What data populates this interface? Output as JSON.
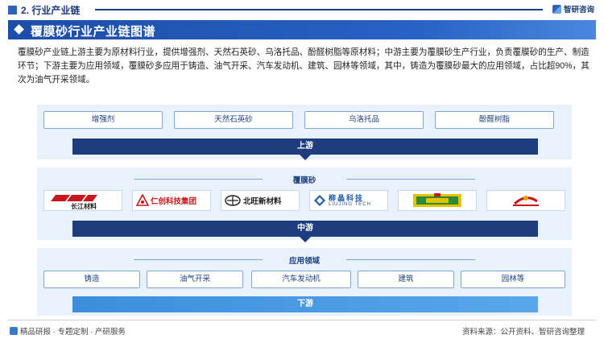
{
  "header": {
    "section": "2. 行业产业链",
    "brand": "智研咨询"
  },
  "title": "覆膜砂行业产业链图谱",
  "description": "覆膜砂产业链上游主要为原材料行业，提供增强剂、天然石英砂、乌洛托品、酚醛树脂等原材料；中游主要为覆膜砂生产行业，负责覆膜砂的生产、制造环节；下游主要为应用领域，覆膜砂多应用于铸造、油气开采、汽车发动机、建筑、园林等领域，其中，铸造为覆膜砂最大的应用领域，占比超90%，其次为油气开采领域。",
  "upstream": {
    "items": [
      "增强剂",
      "天然石英砂",
      "乌洛托品",
      "酚醛树脂"
    ],
    "stage_label": "上游"
  },
  "midstream": {
    "title": "覆膜砂",
    "logos": [
      {
        "name": "长江材料",
        "icon": "changjiang-logo",
        "color": "#c8161d"
      },
      {
        "name": "仁创科技集团",
        "icon": "renchuang-logo",
        "color": "#c8161d"
      },
      {
        "name": "北旺新材料",
        "icon": "beiwang-logo",
        "color": "#1a1a1a"
      },
      {
        "name": "柳晶科技",
        "icon": "liujing-logo",
        "color": "#1e5aa8"
      },
      {
        "name": "",
        "icon": "yellow-green-logo",
        "color": "#e3c200"
      },
      {
        "name": "",
        "icon": "red-swoosh-logo",
        "color": "#c8161d"
      }
    ],
    "logo_sub": {
      "changjiang": "",
      "renchuang": "",
      "beiwang": "",
      "liujing": "LIUJING TECH"
    },
    "stage_label": "中游"
  },
  "downstream": {
    "title": "应用领域",
    "items": [
      "铸造",
      "油气开采",
      "汽车发动机",
      "建筑",
      "园林等"
    ],
    "stage_label": "下游"
  },
  "footer": {
    "left": "精品研报 · 专题定制 · 产研服务",
    "source": "资料来源：公开资料、智研咨询整理"
  },
  "colors": {
    "primary": "#1d3d7e",
    "accent": "#2862c4",
    "band": "#e9f1fb"
  }
}
